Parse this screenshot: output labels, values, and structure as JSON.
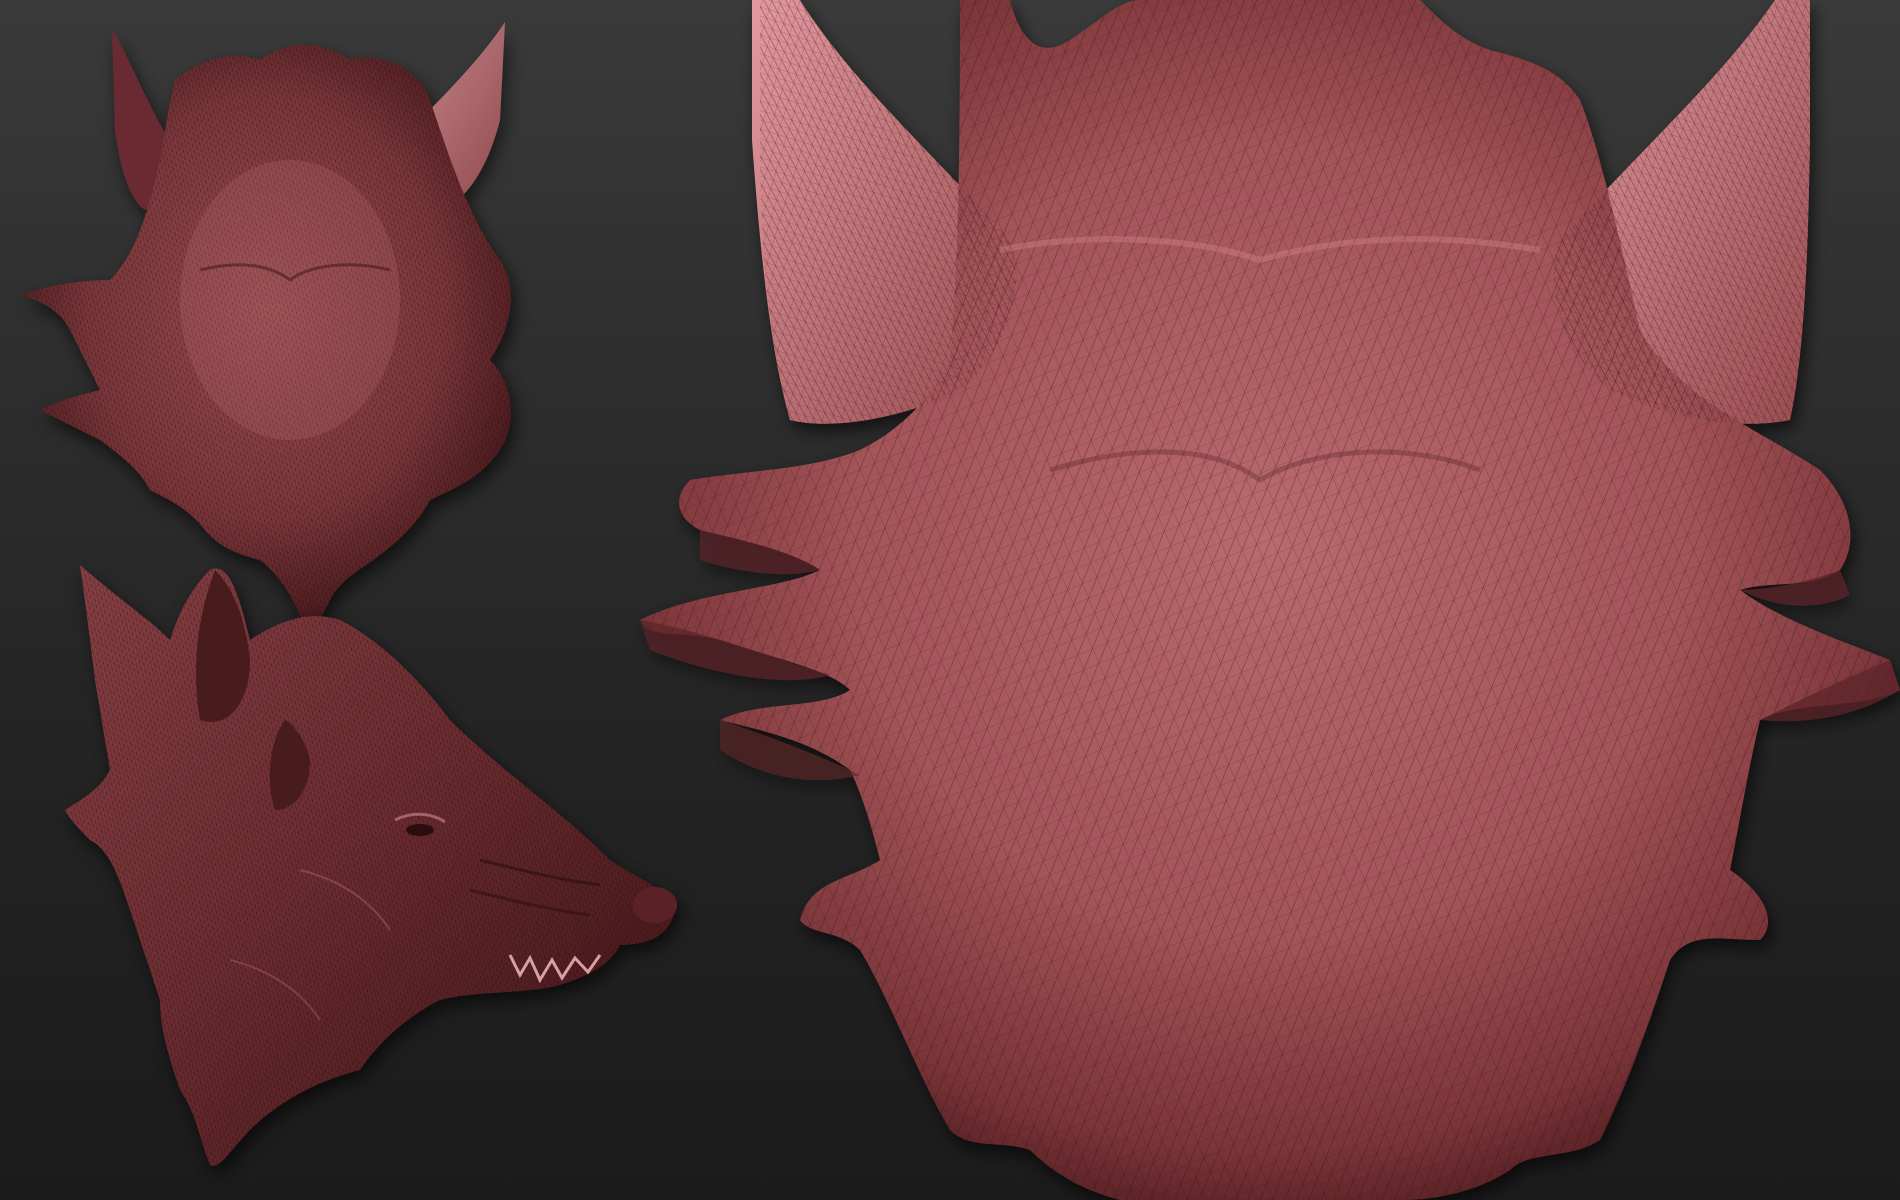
{
  "viewport": {
    "background_top": "#3a3a3a",
    "background_bottom": "#1b1b1b"
  },
  "model": {
    "material_base": "#a85a5e",
    "material_light": "#d98a8f",
    "material_dark": "#5a2428",
    "wire_color": "#2a0e10",
    "views": [
      {
        "name": "top-view-small",
        "display": "wireframe-shaded"
      },
      {
        "name": "side-view-profile",
        "display": "wireframe-shaded"
      },
      {
        "name": "top-view-large",
        "display": "wireframe-shaded"
      }
    ]
  }
}
